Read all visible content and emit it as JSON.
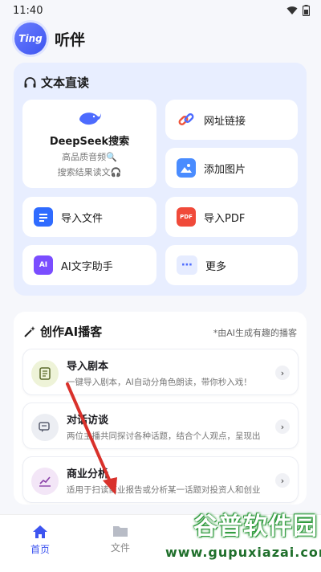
{
  "status": {
    "time": "11:40"
  },
  "app": {
    "logo_text": "Ting",
    "title": "听伴"
  },
  "text_reading": {
    "heading": "文本直读",
    "deepseek": {
      "title": "DeepSeek搜索",
      "line1": "高品质音频🔍",
      "line2": "搜索结果读文🎧"
    },
    "tiles": [
      {
        "label": "网址链接",
        "icon": "link-icon"
      },
      {
        "label": "添加图片",
        "icon": "image-icon"
      },
      {
        "label": "导入文件",
        "icon": "file-icon"
      },
      {
        "label": "导入PDF",
        "icon": "pdf-icon"
      },
      {
        "label": "AI文字助手",
        "icon": "ai-assistant-icon"
      },
      {
        "label": "更多",
        "icon": "more-icon"
      }
    ]
  },
  "create_podcast": {
    "heading": "创作AI播客",
    "hint": "*由AI生成有趣的播客",
    "items": [
      {
        "title": "导入剧本",
        "desc": "一键导入剧本，AI自动分角色朗读，带你秒入戏！",
        "icon": "script-icon"
      },
      {
        "title": "对话访谈",
        "desc": "两位主播共同探讨各种话题，结合个人观点，呈现出",
        "icon": "dialog-icon"
      },
      {
        "title": "商业分析",
        "desc": "适用于扫读商业报告或分析某一话题对投资人和创业",
        "icon": "chart-icon"
      }
    ]
  },
  "nav": {
    "home": "首页",
    "files": "文件"
  },
  "watermark": {
    "main": "谷普软件园",
    "url": "www.gupuxiazai.com"
  },
  "colors": {
    "accent": "#3d54f0",
    "section_bg": "#e8eeff",
    "watermark_green": "#2f9a3d"
  }
}
